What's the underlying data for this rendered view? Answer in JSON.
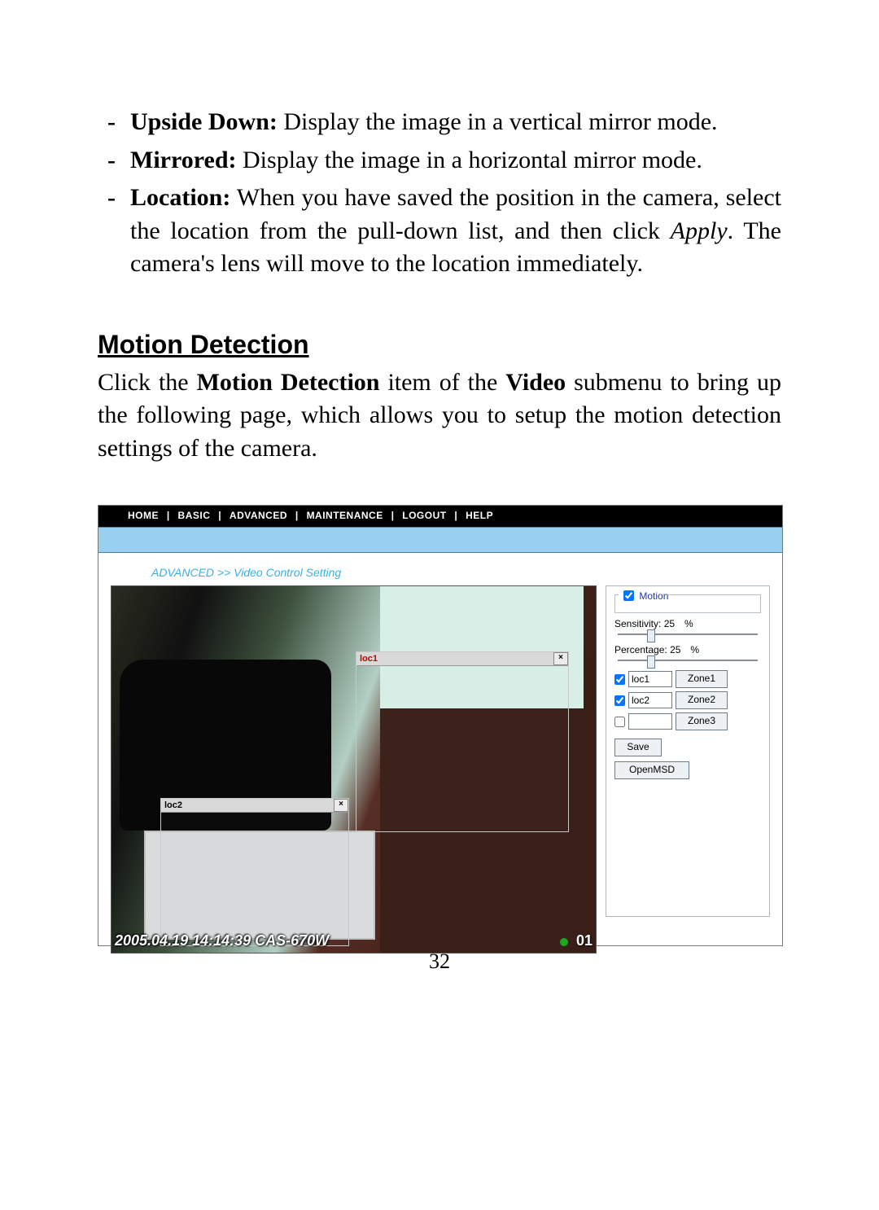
{
  "bullets": [
    {
      "term": "Upside Down:",
      "text": " Display the image in a vertical mirror mode."
    },
    {
      "term": "Mirrored:",
      "text": " Display the image in a horizontal mirror mode."
    },
    {
      "term": "Location:",
      "text": " When you have saved the position in the camera, select the location from the pull-down list, and then click ",
      "italic": "Apply",
      "text2": ".  The camera's lens will move to the location immediately."
    }
  ],
  "section_title": "Motion Detection",
  "section_text_pre": "Click the ",
  "section_text_b1": "Motion Detection",
  "section_text_mid": " item of the ",
  "section_text_b2": "Video",
  "section_text_post": " submenu to bring up the following page, which allows you to setup the motion detection settings of the camera.",
  "page_number": "32",
  "ui": {
    "menu": [
      "HOME",
      "BASIC",
      "ADVANCED",
      "MAINTENANCE",
      "LOGOUT",
      "HELP"
    ],
    "breadcrumb": "ADVANCED >> Video Control Setting",
    "zone1": {
      "name": "loc1",
      "close": "×"
    },
    "zone2": {
      "name": "loc2",
      "close": "×"
    },
    "timestamp": "2005.04.19 14:14:39 CAS-670W",
    "counter": "01",
    "motion_label": "Motion",
    "sensitivity": {
      "label": "Sensitivity:",
      "value": "25",
      "unit": "%"
    },
    "percentage": {
      "label": "Percentage:",
      "value": "25",
      "unit": "%"
    },
    "rows": [
      {
        "checked": true,
        "loc": "loc1",
        "btn": "Zone1"
      },
      {
        "checked": true,
        "loc": "loc2",
        "btn": "Zone2"
      },
      {
        "checked": false,
        "loc": "",
        "btn": "Zone3"
      }
    ],
    "save": "Save",
    "openmsd": "OpenMSD"
  }
}
